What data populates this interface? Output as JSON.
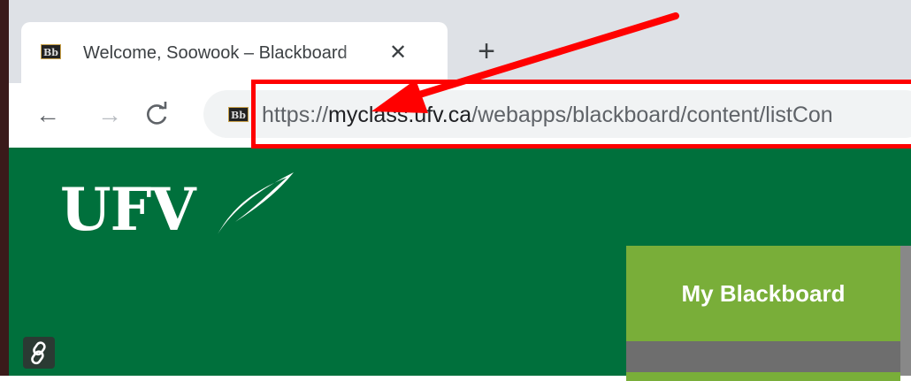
{
  "browser": {
    "tab": {
      "favicon_text": "Bb",
      "title": "Welcome, Soowook – Blackboard",
      "close_glyph": "✕"
    },
    "new_tab_glyph": "+",
    "nav": {
      "back": "←",
      "forward": "→",
      "reload": "C"
    },
    "address_bar": {
      "favicon_text": "Bb",
      "url_scheme": "https://",
      "url_host": "myclass.ufv.ca",
      "url_path": "/webapps/blackboard/content/listCon"
    },
    "annotation_color": "#ff0000"
  },
  "page": {
    "logo_text": "UFV",
    "nav_button_label": "My Blackboard",
    "link_badge_icon": "link-icon",
    "brand_green": "#00703c",
    "accent_green": "#79ae39"
  }
}
